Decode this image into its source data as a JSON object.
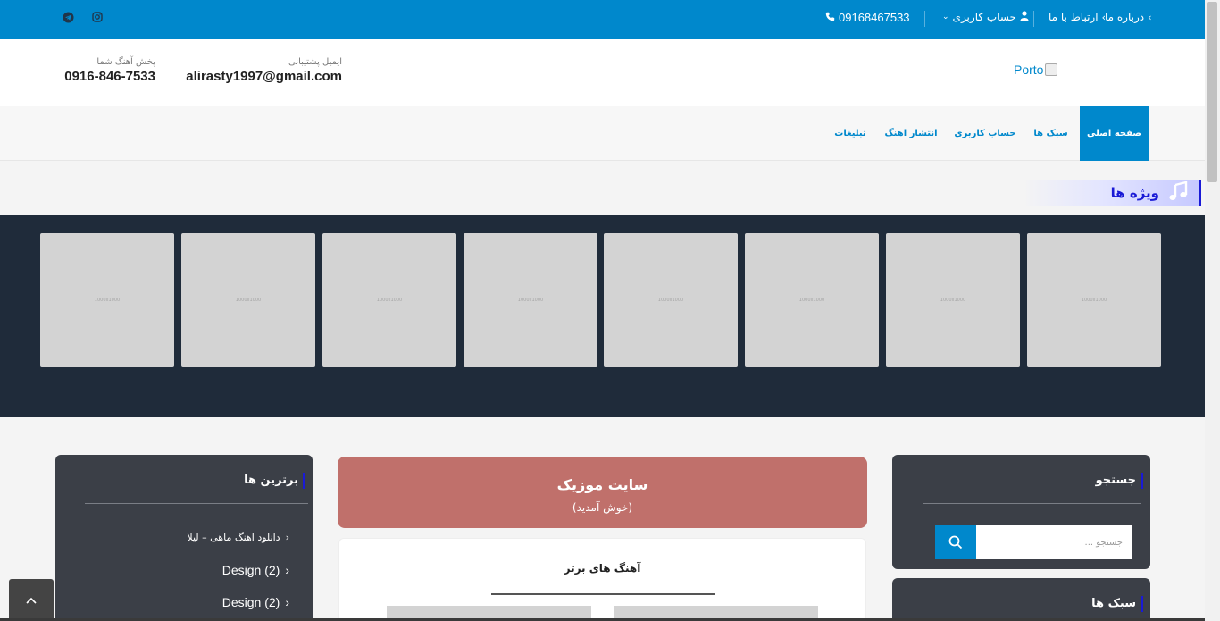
{
  "topbar": {
    "about_label": "درباره ما",
    "contact_label": "ارتباط با ما",
    "account_label": "حساب کاربری",
    "phone_label": "09168467533",
    "social_icons": [
      "telegram-icon",
      "instagram-icon"
    ]
  },
  "header": {
    "logo_alt": "Porto",
    "email_label": "ایمیل پشتیبانی",
    "email_value": "alirasty1997@gmail.com",
    "phone_label": "پخش آهنگ شما",
    "phone_value": "0916-846-7533"
  },
  "nav": {
    "items": [
      {
        "label": "صفحه اصلی",
        "active": true
      },
      {
        "label": "سبک ها",
        "active": false
      },
      {
        "label": "حساب کاربری",
        "active": false
      },
      {
        "label": "انتشار اهنگ",
        "active": false
      },
      {
        "label": "تبلیغات",
        "active": false
      }
    ]
  },
  "featured": {
    "title": "ویژه ها",
    "thumb_placeholder": "1000x1000"
  },
  "search_panel": {
    "title": "جستجو",
    "placeholder": "جستجو ..."
  },
  "genres_panel": {
    "title": "سبک ها"
  },
  "best_panel": {
    "title": "برترین ها",
    "items": [
      "دانلود اهنگ ماهی – لیلا",
      "Design (2)",
      "Design (2)"
    ]
  },
  "welcome": {
    "title": "سایت موزیک",
    "subtitle": "(خوش آمدید)"
  },
  "top_songs": {
    "title": "آهنگ های برتر"
  },
  "colors": {
    "primary": "#0088cc",
    "dark_panel": "#3b3f47",
    "hero_bg": "#1f2b3a",
    "welcome_bg": "#c0706b",
    "accent_bar": "#1a1ad6"
  }
}
